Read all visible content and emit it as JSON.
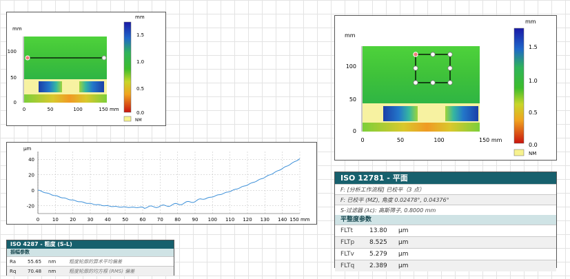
{
  "map_small": {
    "y_unit": "mm",
    "y_ticks": [
      "100",
      "50",
      "0"
    ],
    "x_ticks": [
      "0",
      "50",
      "100",
      "150 mm"
    ],
    "colorbar_unit": "mm",
    "colorbar_ticks": [
      "1.5",
      "1.0",
      "0.5",
      "0.0"
    ],
    "nm_label": "NM"
  },
  "profile": {
    "y_unit": "µm",
    "y_ticks": [
      "40",
      "20",
      "0",
      "-20"
    ],
    "x_ticks": [
      "0",
      "10",
      "20",
      "30",
      "40",
      "50",
      "60",
      "70",
      "80",
      "90",
      "100",
      "110",
      "120",
      "130",
      "140",
      "150 mm"
    ],
    "curve_color": "#3b8fd8"
  },
  "roughness_table": {
    "title": "ISO 4287 - 粗度 (S-L)",
    "section": "振幅参数",
    "rows": [
      {
        "name": "Ra",
        "value": "55.65",
        "unit": "nm",
        "desc": "粗度轮廓的算术平均偏差"
      },
      {
        "name": "Rq",
        "value": "70.48",
        "unit": "nm",
        "desc": "粗度轮廓的均方根 (RMS) 偏差"
      }
    ]
  },
  "map_large": {
    "y_unit": "mm",
    "y_ticks": [
      "100",
      "50",
      "0"
    ],
    "x_ticks": [
      "0",
      "50",
      "100",
      "150 mm"
    ],
    "colorbar_unit": "mm",
    "colorbar_ticks": [
      "1.5",
      "1.0",
      "0.5",
      "0.0"
    ],
    "nm_label": "NM"
  },
  "flatness_table": {
    "title": "ISO  12781  - 平面",
    "info": [
      "F: [分析工作流程] 已校平（3 点）",
      "F: 已校平 (MZ), 角度 0.02478°, 0.04376°",
      "S-过滤器 (λc): 高斯筛子, 0.8000 mm"
    ],
    "section": "平整度参数",
    "rows": [
      {
        "name": "FLTt",
        "value": "13.80",
        "unit": "µm"
      },
      {
        "name": "FLTp",
        "value": "8.525",
        "unit": "µm"
      },
      {
        "name": "FLTv",
        "value": "5.279",
        "unit": "µm"
      },
      {
        "name": "FLTq",
        "value": "2.389",
        "unit": "µm"
      }
    ]
  }
}
